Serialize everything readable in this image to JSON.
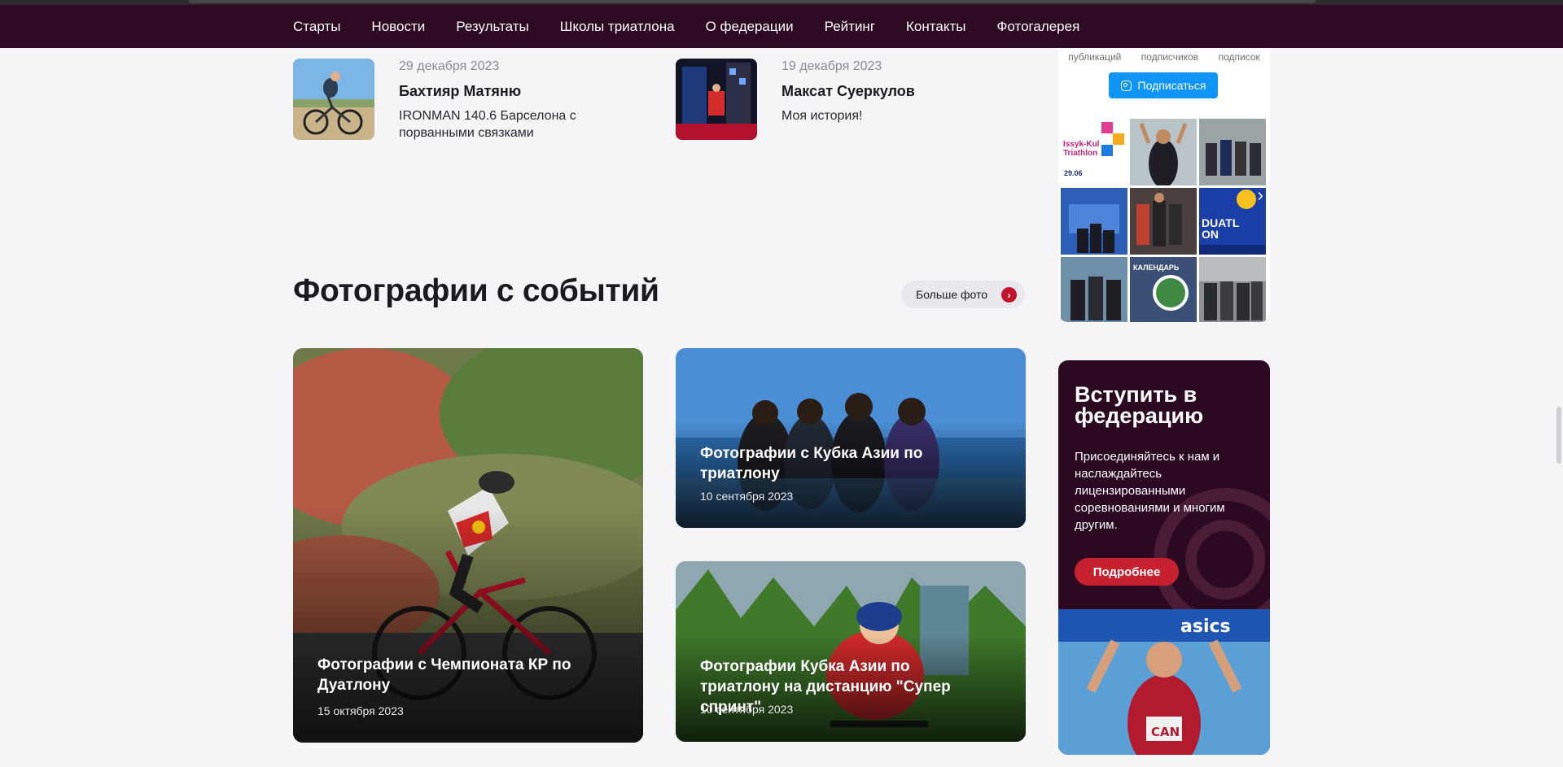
{
  "nav": {
    "items": [
      "Старты",
      "Новости",
      "Результаты",
      "Школы триатлона",
      "О федерации",
      "Рейтинг",
      "Контакты",
      "Фотогалерея"
    ]
  },
  "news": [
    {
      "date": "29 декабря 2023",
      "author": "Бахтияр Матяню",
      "title": "IRONMAN 140.6 Барселона с порванными связками"
    },
    {
      "date": "19 декабря 2023",
      "author": "Максат Суеркулов",
      "title": "Моя история!"
    }
  ],
  "gallery": {
    "title": "Фотографии с событий",
    "more_label": "Больше фото",
    "more_icon": "chevron-right-icon",
    "cards": [
      {
        "title": "Фотографии с Чемпионата КР по Дуатлону",
        "date": "15 октября 2023"
      },
      {
        "title": "Фотографии с Кубка Азии по триатлону",
        "date": "10 сентября 2023"
      },
      {
        "title": "Фотографии Кубка Азии по триатлону на дистанцию \"Супер спринт\"",
        "date": "10 сентября 2023"
      }
    ]
  },
  "instagram": {
    "stats": [
      "публикаций",
      "подписчиков",
      "подписок"
    ],
    "subscribe_label": "Подписаться",
    "tiles": [
      {
        "text": "Issyk-Kul Triathlon",
        "sub": "29.06"
      },
      {
        "text": ""
      },
      {
        "text": ""
      },
      {
        "text": ""
      },
      {
        "text": ""
      },
      {
        "text": "DUATLON"
      },
      {
        "text": ""
      },
      {
        "text": "КАЛЕНДАРЬ"
      },
      {
        "text": ""
      }
    ],
    "next_icon": "chevron-right-icon"
  },
  "join": {
    "title": "Вступить в федерацию",
    "text": "Присоединяйтесь к нам и наслаждайтесь лицензированными соревнованиями и многим другим.",
    "button_label": "Подробнее",
    "photo": {
      "banner": "asics",
      "bib": "CAN"
    }
  },
  "colors": {
    "navbar": "#2d0a22",
    "accent_red": "#c3122a",
    "instagram_blue": "#0f95f6",
    "join_bg": "#2b0920"
  }
}
